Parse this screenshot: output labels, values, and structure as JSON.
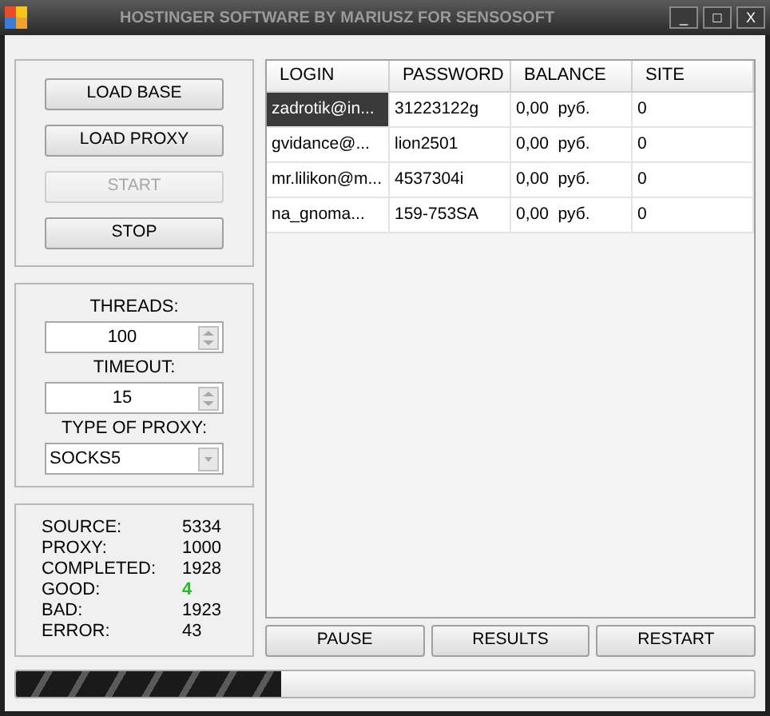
{
  "window": {
    "title": "HOSTINGER SOFTWARE BY MARIUSZ FOR SENSOSOFT",
    "controls": [
      "_",
      "□",
      "X"
    ]
  },
  "actions": [
    {
      "label": "LOAD BASE",
      "disabled": false
    },
    {
      "label": "LOAD PROXY",
      "disabled": false
    },
    {
      "label": "START",
      "disabled": true
    },
    {
      "label": "STOP",
      "disabled": false
    }
  ],
  "settings": {
    "threads_label": "THREADS:",
    "threads": "100",
    "timeout_label": "TIMEOUT:",
    "timeout": "15",
    "proxy_type_label": "TYPE OF PROXY:",
    "proxy_type": "SOCKS5"
  },
  "stats": [
    {
      "label": "SOURCE:",
      "value": "5334",
      "highlight": false
    },
    {
      "label": "PROXY:",
      "value": "1000",
      "highlight": false
    },
    {
      "label": "COMPLETED:",
      "value": "1928",
      "highlight": false
    },
    {
      "label": "GOOD:",
      "value": "4",
      "highlight": true
    },
    {
      "label": "BAD:",
      "value": "1923",
      "highlight": false
    },
    {
      "label": "ERROR:",
      "value": "43",
      "highlight": false
    }
  ],
  "table": {
    "columns": [
      "LOGIN",
      "PASSWORD",
      "BALANCE",
      "SITE"
    ],
    "rows": [
      {
        "cells": [
          "zadrotik@in...",
          "31223122g",
          "0,00  руб.",
          "0"
        ],
        "selected": true
      },
      {
        "cells": [
          "gvidance@...",
          "lion2501",
          "0,00  руб.",
          "0"
        ],
        "selected": false
      },
      {
        "cells": [
          "mr.lilikon@m...",
          "4537304i",
          "0,00  руб.",
          "0"
        ],
        "selected": false
      },
      {
        "cells": [
          "na_gnoma...",
          "159-753SA",
          "0,00  руб.",
          "0"
        ],
        "selected": false
      }
    ]
  },
  "bottom_buttons": [
    "PAUSE",
    "RESULTS",
    "RESTART"
  ],
  "progress": {
    "level": 0.36
  }
}
